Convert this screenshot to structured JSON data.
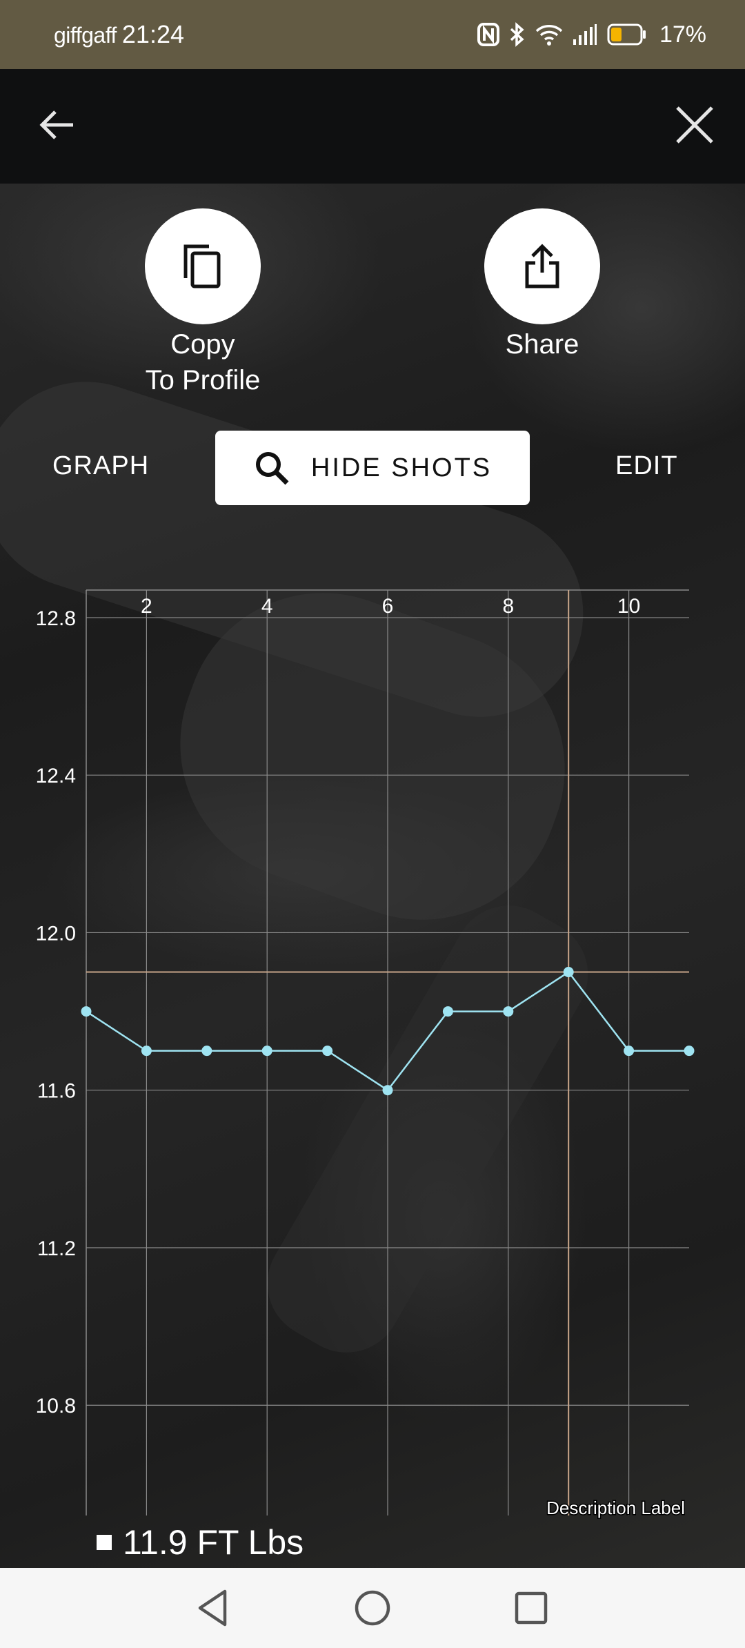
{
  "status_bar": {
    "carrier": "giffgaff",
    "time": "21:24",
    "battery_percent": "17%",
    "battery_level": 0.17,
    "icons": [
      "nfc-icon",
      "bluetooth-icon",
      "wifi-icon",
      "signal-icon",
      "battery-icon"
    ]
  },
  "app_bar": {
    "back_icon": "arrow-left-icon",
    "close_icon": "close-icon"
  },
  "actions": {
    "copy": {
      "label_line1": "Copy",
      "label_line2": "To Profile",
      "icon": "copy-icon"
    },
    "share": {
      "label": "Share",
      "icon": "share-icon"
    }
  },
  "toolbar": {
    "graph_label": "GRAPH",
    "hide_shots_label": "HIDE SHOTS",
    "hide_shots_icon": "search-icon",
    "edit_label": "EDIT"
  },
  "colors": {
    "status_bar": "#625a43",
    "series_line": "#9fe4f2",
    "reference_line": "#c9a68a",
    "grid": "#8a8a8a"
  },
  "chart_data": {
    "type": "line",
    "x": [
      1,
      2,
      3,
      4,
      5,
      6,
      7,
      8,
      9,
      10,
      11
    ],
    "series": [
      {
        "values": [
          11.8,
          11.7,
          11.7,
          11.7,
          11.7,
          11.6,
          11.8,
          11.8,
          11.9,
          11.7,
          11.7
        ]
      }
    ],
    "x_ticks": [
      2,
      4,
      6,
      8,
      10
    ],
    "y_ticks": [
      10.8,
      11.2,
      11.6,
      12.0,
      12.4,
      12.8
    ],
    "x_axis_position": "top",
    "xlim": [
      1,
      11
    ],
    "ylim": [
      10.52,
      12.87
    ],
    "grid": true,
    "highlight": {
      "x": 9,
      "y": 11.9
    },
    "description_label": "Description Label",
    "legend": {
      "label": "11.9 FT Lbs",
      "placement": "bottom-left"
    }
  },
  "nav_bar": {
    "icons": [
      "back-triangle-icon",
      "home-circle-icon",
      "recents-square-icon"
    ]
  }
}
